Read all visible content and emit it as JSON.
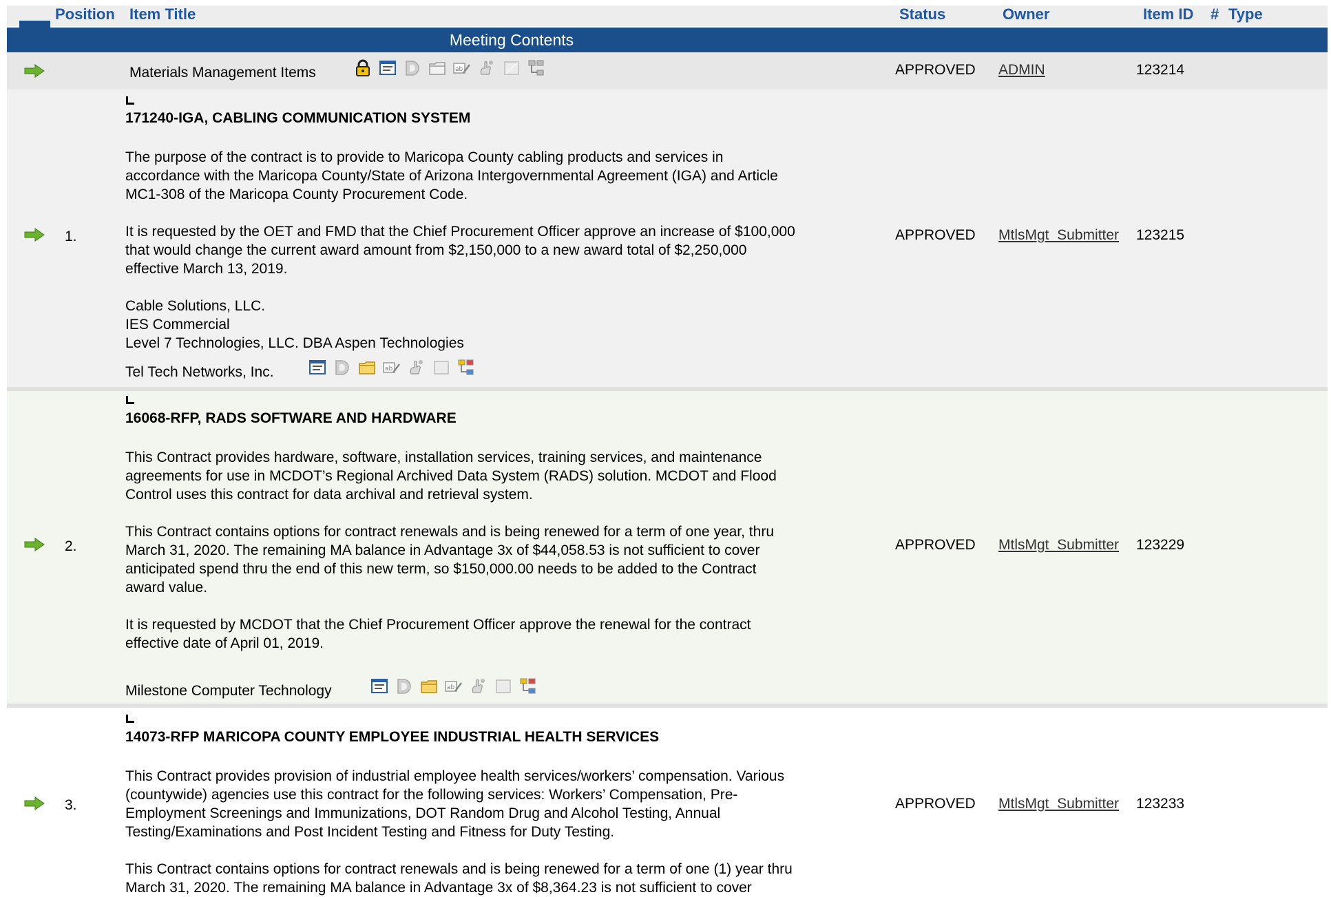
{
  "header": {
    "position": "Position",
    "item_title": "Item Title",
    "status": "Status",
    "owner": "Owner",
    "item_id": "Item ID",
    "hash": "#",
    "type": "Type"
  },
  "meeting_contents": "Meeting Contents",
  "top_item": {
    "title": "Materials Management Items",
    "status": "APPROVED",
    "owner": "ADMIN",
    "item_id": "123214"
  },
  "items": [
    {
      "position": "1.",
      "heading": "171240-IGA, CABLING COMMUNICATION SYSTEM",
      "lines": [
        "The purpose of the contract is to provide to Maricopa County cabling products and services in",
        "accordance with the Maricopa County/State of Arizona Intergovernmental Agreement (IGA) and Article",
        "MC1-308 of the Maricopa County Procurement Code.",
        "",
        "It is requested by the OET and FMD that the Chief Procurement Officer approve an increase of $100,000",
        "that would change the current award amount from $2,150,000 to a new award total of $2,250,000",
        "effective March 13, 2019.",
        "",
        "Cable Solutions, LLC.",
        "IES Commercial",
        "Level 7 Technologies, LLC. DBA Aspen Technologies"
      ],
      "last_line": "Tel Tech Networks, Inc.",
      "status": "APPROVED",
      "owner": "MtlsMgt_Submitter",
      "item_id": "123215"
    },
    {
      "position": "2.",
      "heading": "16068-RFP, RADS SOFTWARE AND HARDWARE",
      "lines": [
        "This Contract provides hardware, software, installation services, training services, and maintenance",
        "agreements for use in MCDOT’s Regional Archived Data System (RADS) solution. MCDOT and Flood",
        "Control uses this contract for data archival and retrieval system.",
        "",
        "This Contract contains options for contract renewals and is being renewed for a term of one year, thru",
        "March 31, 2020. The remaining MA balance in Advantage 3x of $44,058.53 is not sufficient to cover",
        "anticipated spend thru the end of this new term, so $150,000.00 needs to be added to the Contract",
        "award value.",
        "",
        "It is requested by MCDOT that the Chief Procurement Officer approve the renewal for the contract",
        "effective date of April 01, 2019."
      ],
      "last_line": "Milestone Computer Technology",
      "status": "APPROVED",
      "owner": "MtlsMgt_Submitter",
      "item_id": "123229"
    },
    {
      "position": "3.",
      "heading": "14073-RFP MARICOPA COUNTY EMPLOYEE INDUSTRIAL HEALTH SERVICES",
      "lines": [
        "This Contract provides provision of industrial employee health services/workers’ compensation. Various",
        "(countywide) agencies use this contract for the following services: Workers’ Compensation, Pre-",
        "Employment Screenings and Immunizations, DOT Random Drug and Alcohol Testing, Annual",
        "Testing/Examinations and Post Incident Testing and Fitness for Duty Testing.",
        "",
        "This Contract contains options for contract renewals and is being renewed for a term of one (1) year thru",
        "March 31, 2020. The remaining MA balance in Advantage 3x of $8,364.23 is not sufficient to cover"
      ],
      "status": "APPROVED",
      "owner": "MtlsMgt_Submitter",
      "item_id": "123233"
    }
  ],
  "icons": [
    "lock-icon",
    "summary-icon",
    "d-doc-icon",
    "folder-icon",
    "edit-text-icon",
    "hand-icon",
    "page-icon",
    "tree-icon"
  ],
  "colors": {
    "header_blue": "#1a4f8b",
    "header_text": "#1f58a6",
    "arrow_green": "#6bb32e"
  }
}
